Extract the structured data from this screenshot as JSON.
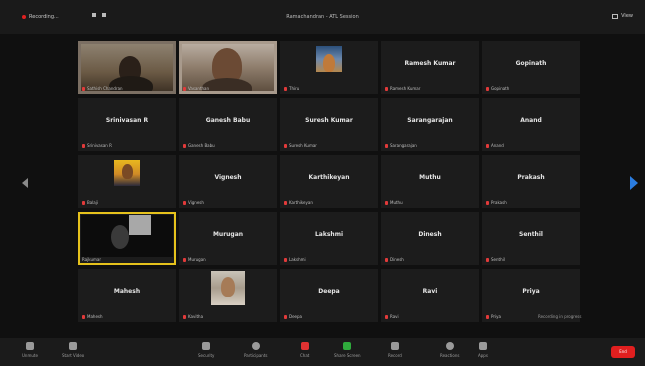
{
  "app": {
    "title": "Zoom Meeting",
    "accent": "#2b7de0",
    "record_color": "#e02020",
    "active_speaker_color": "#e6c21c",
    "top": {
      "recording_label": "Recording...",
      "meeting_title": "Ramachandran - ATL Session",
      "view_label": "View"
    }
  },
  "participants": [
    {
      "name": "",
      "label": "Sathish Chandran",
      "kind": "video"
    },
    {
      "name": "",
      "label": "Vasanthan",
      "kind": "video2"
    },
    {
      "name": "",
      "label": "Thiru",
      "kind": "thumb1"
    },
    {
      "name": "Ramesh Kumar",
      "label": "Ramesh Kumar",
      "kind": "name"
    },
    {
      "name": "Gopinath",
      "label": "Gopinath",
      "kind": "name"
    },
    {
      "name": "Srinivasan R",
      "label": "Srinivasan R",
      "kind": "name"
    },
    {
      "name": "Ganesh Babu",
      "label": "Ganesh Babu",
      "kind": "name"
    },
    {
      "name": "Suresh Kumar",
      "label": "Suresh Kumar",
      "kind": "name"
    },
    {
      "name": "Sarangarajan",
      "label": "Sarangarajan",
      "kind": "name"
    },
    {
      "name": "Anand",
      "label": "Anand",
      "kind": "name"
    },
    {
      "name": "",
      "label": "Balaji",
      "kind": "thumb2"
    },
    {
      "name": "Vignesh",
      "label": "Vignesh",
      "kind": "name"
    },
    {
      "name": "Karthikeyan",
      "label": "Karthikeyan",
      "kind": "name"
    },
    {
      "name": "Muthu",
      "label": "Muthu",
      "kind": "name"
    },
    {
      "name": "Prakash",
      "label": "Prakash",
      "kind": "name"
    },
    {
      "name": "",
      "label": "Rajkumar",
      "kind": "dark"
    },
    {
      "name": "Murugan",
      "label": "Murugan",
      "kind": "name"
    },
    {
      "name": "Lakshmi",
      "label": "Lakshmi",
      "kind": "name"
    },
    {
      "name": "Dinesh",
      "label": "Dinesh",
      "kind": "name"
    },
    {
      "name": "Senthil",
      "label": "Senthil",
      "kind": "name"
    },
    {
      "name": "Mahesh",
      "label": "Mahesh",
      "kind": "name"
    },
    {
      "name": "",
      "label": "Kavitha",
      "kind": "thumb3"
    },
    {
      "name": "Deepa",
      "label": "Deepa",
      "kind": "name"
    },
    {
      "name": "Ravi",
      "label": "Ravi",
      "kind": "name"
    },
    {
      "name": "Priya",
      "label": "Priya",
      "kind": "name"
    }
  ],
  "toolbar": {
    "unmute": "Unmute",
    "start_video": "Start Video",
    "security": "Security",
    "participants": "Participants",
    "participants_count": "25",
    "chat": "Chat",
    "share_screen": "Share Screen",
    "record": "Record",
    "reactions": "Reactions",
    "apps": "Apps",
    "end": "End"
  },
  "notice": "Recording in progress"
}
